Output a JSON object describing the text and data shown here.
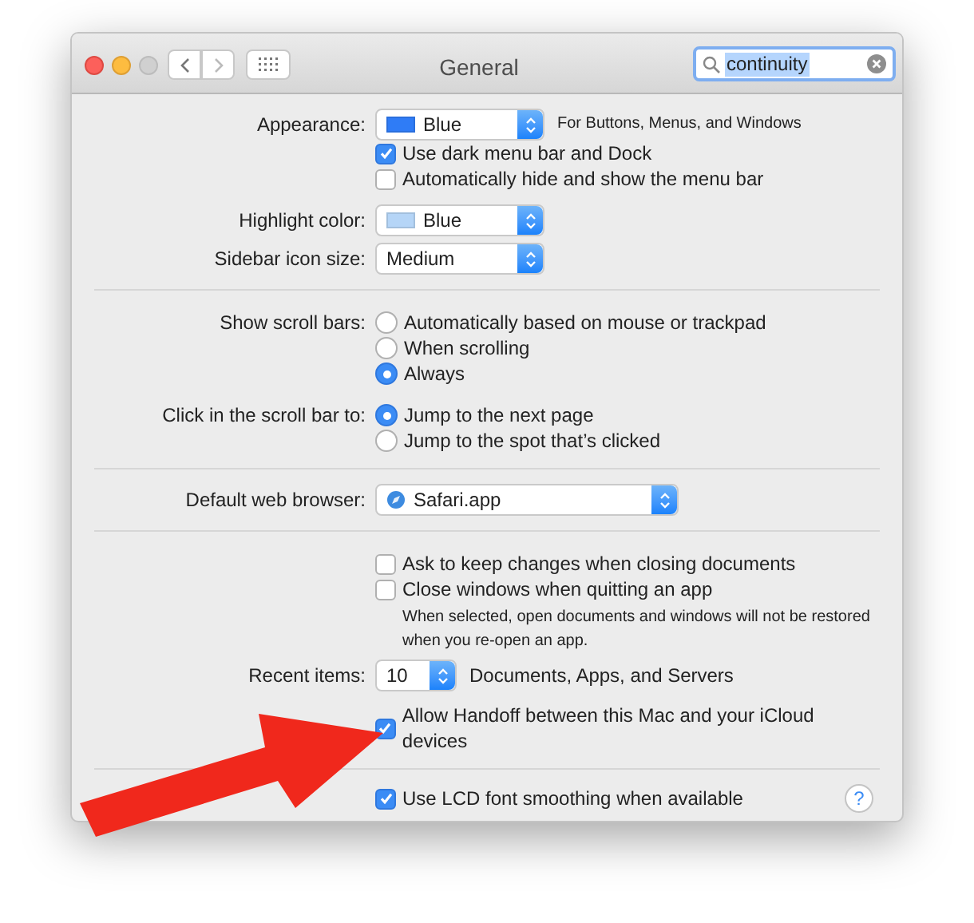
{
  "window": {
    "title": "General"
  },
  "search": {
    "value": "continuity"
  },
  "sections": [
    {
      "rows": [
        {
          "kind": "popup",
          "label": "Appearance:",
          "value": "Blue",
          "color": "#2f7cf6",
          "note": "For Buttons, Menus, and Windows"
        },
        {
          "kind": "checkbox",
          "text": "Use dark menu bar and Dock",
          "checked": true
        },
        {
          "kind": "checkbox",
          "text": "Automatically hide and show the menu bar",
          "checked": false
        },
        {
          "kind": "popup",
          "label": "Highlight color:",
          "value": "Blue",
          "color": "#b5d5f7"
        },
        {
          "kind": "popup",
          "label": "Sidebar icon size:",
          "value": "Medium"
        }
      ]
    },
    {
      "rows": [
        {
          "kind": "radio",
          "label": "Show scroll bars:",
          "text": "Automatically based on mouse or trackpad",
          "selected": false
        },
        {
          "kind": "radio",
          "text": "When scrolling",
          "selected": false
        },
        {
          "kind": "radio",
          "text": "Always",
          "selected": true
        },
        {
          "kind": "radio",
          "label": "Click in the scroll bar to:",
          "text": "Jump to the next page",
          "selected": true
        },
        {
          "kind": "radio",
          "text": "Jump to the spot that’s clicked",
          "selected": false
        }
      ]
    },
    {
      "rows": [
        {
          "kind": "app_popup",
          "label": "Default web browser:",
          "value": "Safari.app"
        }
      ]
    },
    {
      "rows": [
        {
          "kind": "checkbox",
          "text": "Ask to keep changes when closing documents",
          "checked": false
        },
        {
          "kind": "checkbox",
          "text": "Close windows when quitting an app",
          "checked": false
        },
        {
          "kind": "note",
          "text": "When selected, open documents and windows will not be restored when you re-open an app."
        },
        {
          "kind": "stepper",
          "label": "Recent items:",
          "value": "10",
          "note": "Documents, Apps, and Servers"
        },
        {
          "kind": "checkbox",
          "text": "Allow Handoff between this Mac and your iCloud devices",
          "checked": true
        }
      ]
    },
    {
      "rows": [
        {
          "kind": "checkbox",
          "text": "Use LCD font smoothing when available",
          "checked": true
        }
      ]
    }
  ],
  "help_button": "?"
}
